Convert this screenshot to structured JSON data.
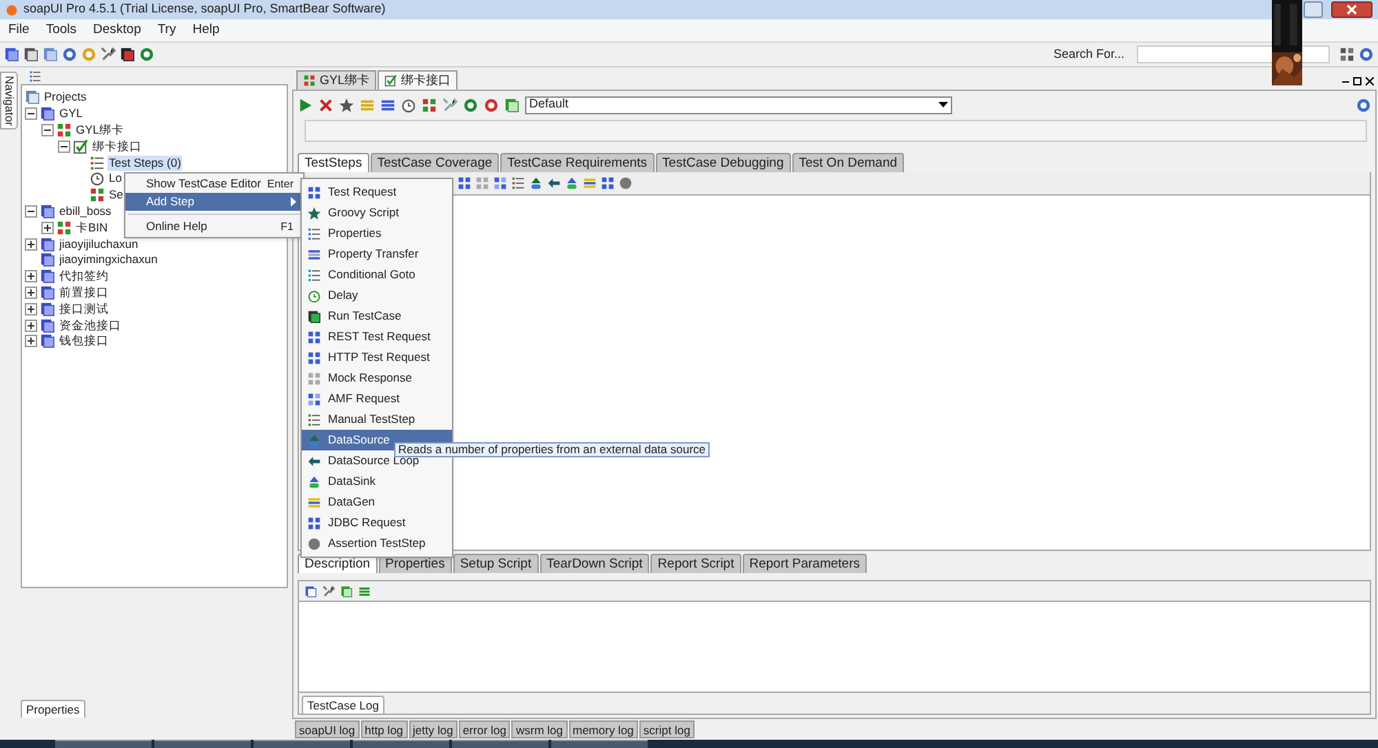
{
  "window": {
    "title": "soapUI Pro 4.5.1 (Trial License, soapUI Pro, SmartBear Software)"
  },
  "menu_bar": [
    "File",
    "Tools",
    "Desktop",
    "Try",
    "Help"
  ],
  "search": {
    "label": "Search For..."
  },
  "navigator": {
    "tab": "Navigator",
    "bottom_tab": "Properties"
  },
  "tree": [
    {
      "label": "Projects",
      "kind": "root",
      "children": [
        {
          "label": "GYL",
          "kind": "project",
          "expanded": true,
          "children": [
            {
              "label": "GYL绑卡",
              "kind": "suite",
              "expanded": true,
              "children": [
                {
                  "label": "绑卡接口",
                  "kind": "case",
                  "expanded": true,
                  "children": [
                    {
                      "label": "Test Steps (0)",
                      "kind": "steps",
                      "selected": true
                    },
                    {
                      "label": "Lo",
                      "kind": "load",
                      "selected": false
                    },
                    {
                      "label": "Se",
                      "kind": "security",
                      "selected": false
                    }
                  ]
                }
              ]
            }
          ]
        },
        {
          "label": "ebill_boss",
          "kind": "project",
          "expanded": true,
          "children": [
            {
              "label": "卡BIN",
              "kind": "suite",
              "expanded": false
            }
          ]
        },
        {
          "label": "jiaoyijiluchaxun",
          "kind": "project",
          "expanded": false
        },
        {
          "label": "jiaoyimingxichaxun",
          "kind": "project"
        },
        {
          "label": "代扣签约",
          "kind": "project",
          "expanded": false
        },
        {
          "label": "前置接口",
          "kind": "project",
          "expanded": false
        },
        {
          "label": "接口测试",
          "kind": "project",
          "expanded": false
        },
        {
          "label": "资金池接口",
          "kind": "project",
          "expanded": false
        },
        {
          "label": "钱包接口",
          "kind": "project",
          "expanded": false
        }
      ]
    }
  ],
  "editor_tabs": [
    {
      "label": "GYL绑卡",
      "selected": false
    },
    {
      "label": "绑卡接口",
      "selected": true
    }
  ],
  "environment": {
    "value": "Default"
  },
  "progress": {
    "level": 0
  },
  "testcase_tabs": [
    {
      "label": "TestSteps",
      "selected": true
    },
    {
      "label": "TestCase Coverage",
      "selected": false
    },
    {
      "label": "TestCase Requirements",
      "selected": false
    },
    {
      "label": "TestCase Debugging",
      "selected": false
    },
    {
      "label": "Test On Demand",
      "selected": false
    }
  ],
  "lower_tabs": [
    {
      "label": "Description",
      "selected": true
    },
    {
      "label": "Properties",
      "selected": false
    },
    {
      "label": "Setup Script",
      "selected": false
    },
    {
      "label": "TearDown Script",
      "selected": false
    },
    {
      "label": "Report Script",
      "selected": false
    },
    {
      "label": "Report Parameters",
      "selected": false
    }
  ],
  "log_panel": {
    "tab": "TestCase Log"
  },
  "log_tabs": [
    "soapUI log",
    "http log",
    "jetty log",
    "error log",
    "wsrm log",
    "memory log",
    "script log"
  ],
  "context_menu": [
    {
      "label": "Show TestCase Editor",
      "shortcut": "Enter",
      "selected": false,
      "submenu": false
    },
    {
      "label": "Add Step",
      "selected": true,
      "submenu": true
    },
    {
      "label": "Online Help",
      "shortcut": "F1",
      "selected": false,
      "submenu": false
    }
  ],
  "add_step_menu": [
    {
      "label": "Test Request",
      "selected": false
    },
    {
      "label": "Groovy Script",
      "selected": false
    },
    {
      "label": "Properties",
      "selected": false
    },
    {
      "label": "Property Transfer",
      "selected": false
    },
    {
      "label": "Conditional Goto",
      "selected": false
    },
    {
      "label": "Delay",
      "selected": false
    },
    {
      "label": "Run TestCase",
      "selected": false
    },
    {
      "label": "REST Test Request",
      "selected": false
    },
    {
      "label": "HTTP Test Request",
      "selected": false
    },
    {
      "label": "Mock Response",
      "selected": false
    },
    {
      "label": "AMF Request",
      "selected": false
    },
    {
      "label": "Manual TestStep",
      "selected": false
    },
    {
      "label": "DataSource",
      "selected": true
    },
    {
      "label": "DataSource Loop",
      "selected": false
    },
    {
      "label": "DataSink",
      "selected": false
    },
    {
      "label": "DataGen",
      "selected": false
    },
    {
      "label": "JDBC Request",
      "selected": false
    },
    {
      "label": "Assertion TestStep",
      "selected": false
    }
  ],
  "tooltip": "Reads a number of properties from an external data source"
}
